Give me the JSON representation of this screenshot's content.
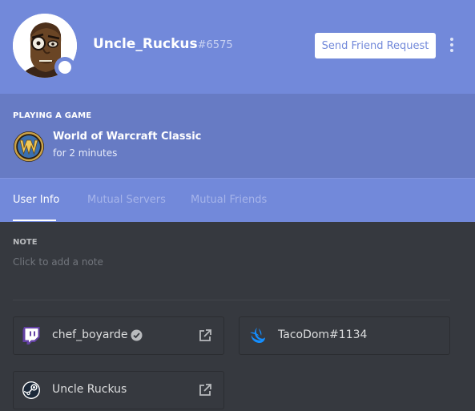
{
  "profile": {
    "username": "Uncle_Ruckus",
    "discriminator": "#6575",
    "avatar_icon": "avatar-portrait-icon",
    "status_icon": "status-dot-icon"
  },
  "header": {
    "friend_button_label": "Send Friend Request",
    "more_icon": "more-vertical-icon"
  },
  "activity": {
    "title": "PLAYING A GAME",
    "game_name": "World of Warcraft Classic",
    "elapsed": "for 2 minutes",
    "game_icon": "wow-logo-icon"
  },
  "tabs": [
    {
      "label": "User Info",
      "active": true
    },
    {
      "label": "Mutual Servers",
      "active": false
    },
    {
      "label": "Mutual Friends",
      "active": false
    }
  ],
  "note": {
    "label": "NOTE",
    "placeholder": "Click to add a note"
  },
  "connected_accounts": [
    {
      "service_icon": "twitch-icon",
      "name": "chef_boyarde",
      "verified": true,
      "external_link": true
    },
    {
      "service_icon": "battlenet-icon",
      "name": "TacoDom#1134",
      "verified": false,
      "external_link": false
    },
    {
      "service_icon": "steam-icon",
      "name": "Uncle Ruckus",
      "verified": false,
      "external_link": true
    }
  ],
  "colors": {
    "brand_blurple": "#7289da",
    "activity_bg": "#677bc4",
    "content_bg": "#36393f",
    "twitch_purple": "#6441a5",
    "battlenet_blue": "#148eff"
  }
}
